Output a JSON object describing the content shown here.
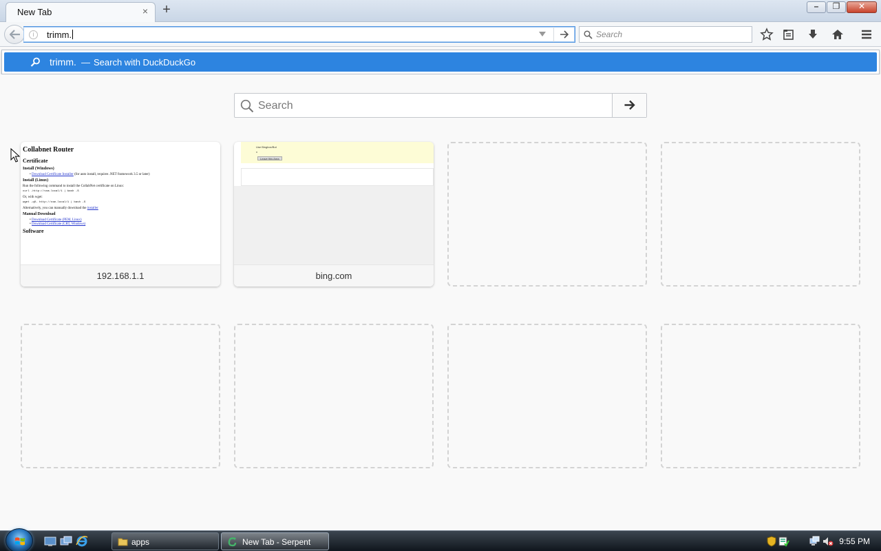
{
  "tab": {
    "title": "New Tab",
    "close_glyph": "×",
    "new_tab_glyph": "+"
  },
  "window_controls": {
    "minimize": "minimize-icon",
    "restore": "restore-icon",
    "close": "close-icon"
  },
  "navbar": {
    "url_value": "trimm.",
    "search_placeholder": "Search",
    "icons": [
      "back-arrow-icon",
      "info-icon",
      "dropdown-icon",
      "go-arrow-icon",
      "search-icon",
      "bookmark-star-icon",
      "reading-list-icon",
      "download-icon",
      "home-icon",
      "menu-icon"
    ]
  },
  "autocomplete": {
    "query": "trimm.",
    "separator": "—",
    "action": "Search with DuckDuckGo"
  },
  "newtab": {
    "search_placeholder": "Search",
    "tiles": [
      {
        "caption": "192.168.1.1",
        "thumb": {
          "title": "Collabnet Router",
          "section1": "Certificate",
          "sub1": "Install (Windows)",
          "link1": "Download Certificate Installer",
          "link1_note": "(for auto install, requires .NET framework 3.5 or later)",
          "sub2": "Install (Linux)",
          "p1": "Run the following command to install the CollabNet certificate on Linux:",
          "code1": "curl -http://ssm.local/1 | bash -S",
          "p2": "Or, with wget:",
          "code2": "wget -qO- http://ssm.local/1 | bash -S",
          "p3_prefix": "Alternatively, you can manually download the",
          "p3_link": "installer",
          "sub3": "Manual Download",
          "link2": "Download Certificate (PEM, Linux)",
          "link3": "Download Certificate (CRT, Windows)",
          "section2": "Software"
        }
      },
      {
        "caption": "bing.com",
        "thumb": {
          "text": "Use Bingbox/Bot",
          "dot": "x",
          "button": "Leave this Area"
        }
      }
    ]
  },
  "taskbar": {
    "items": [
      {
        "label": "apps",
        "icon": "folder-icon"
      },
      {
        "label": "New Tab - Serpent",
        "icon": "serpent-browser-icon"
      }
    ],
    "quick_launch": [
      "show-desktop-icon",
      "window-switcher-icon",
      "internet-explorer-icon"
    ],
    "tray": [
      "shield-icon",
      "action-center-icon",
      "network-icon",
      "volume-muted-icon"
    ],
    "clock": "9:55 PM"
  }
}
